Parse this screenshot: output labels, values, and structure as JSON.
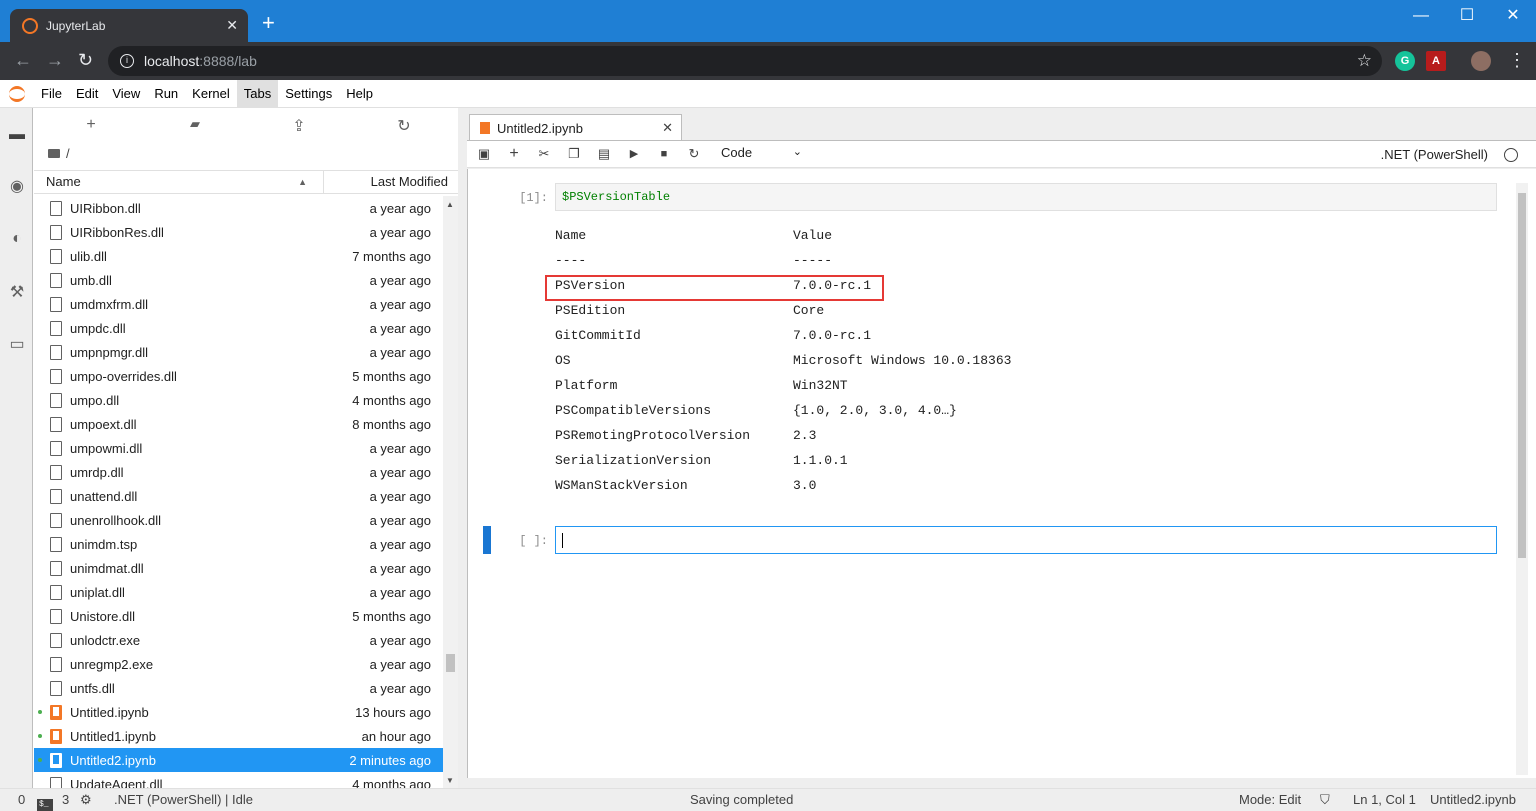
{
  "browser": {
    "tab_title": "JupyterLab",
    "tab_close": "✕",
    "new_tab": "+",
    "url_host": "localhost",
    "url_path": ":8888/lab",
    "window_min": "—",
    "window_max": "☐",
    "window_close": "✕",
    "ext_grammarly": "G",
    "ext_pdf": "A"
  },
  "menubar": {
    "items": [
      "File",
      "Edit",
      "View",
      "Run",
      "Kernel",
      "Tabs",
      "Settings",
      "Help"
    ],
    "active": "Tabs"
  },
  "filebrowser": {
    "path": "/",
    "col_name": "Name",
    "col_modified": "Last Modified",
    "files": [
      {
        "name": "UIRibbon.dll",
        "modified": "a year ago",
        "type": "file"
      },
      {
        "name": "UIRibbonRes.dll",
        "modified": "a year ago",
        "type": "file"
      },
      {
        "name": "ulib.dll",
        "modified": "7 months ago",
        "type": "file"
      },
      {
        "name": "umb.dll",
        "modified": "a year ago",
        "type": "file"
      },
      {
        "name": "umdmxfrm.dll",
        "modified": "a year ago",
        "type": "file"
      },
      {
        "name": "umpdc.dll",
        "modified": "a year ago",
        "type": "file"
      },
      {
        "name": "umpnpmgr.dll",
        "modified": "a year ago",
        "type": "file"
      },
      {
        "name": "umpo-overrides.dll",
        "modified": "5 months ago",
        "type": "file"
      },
      {
        "name": "umpo.dll",
        "modified": "4 months ago",
        "type": "file"
      },
      {
        "name": "umpoext.dll",
        "modified": "8 months ago",
        "type": "file"
      },
      {
        "name": "umpowmi.dll",
        "modified": "a year ago",
        "type": "file"
      },
      {
        "name": "umrdp.dll",
        "modified": "a year ago",
        "type": "file"
      },
      {
        "name": "unattend.dll",
        "modified": "a year ago",
        "type": "file"
      },
      {
        "name": "unenrollhook.dll",
        "modified": "a year ago",
        "type": "file"
      },
      {
        "name": "unimdm.tsp",
        "modified": "a year ago",
        "type": "file"
      },
      {
        "name": "unimdmat.dll",
        "modified": "a year ago",
        "type": "file"
      },
      {
        "name": "uniplat.dll",
        "modified": "a year ago",
        "type": "file"
      },
      {
        "name": "Unistore.dll",
        "modified": "5 months ago",
        "type": "file"
      },
      {
        "name": "unlodctr.exe",
        "modified": "a year ago",
        "type": "file"
      },
      {
        "name": "unregmp2.exe",
        "modified": "a year ago",
        "type": "file"
      },
      {
        "name": "untfs.dll",
        "modified": "a year ago",
        "type": "file"
      },
      {
        "name": "Untitled.ipynb",
        "modified": "13 hours ago",
        "type": "notebook",
        "running": true
      },
      {
        "name": "Untitled1.ipynb",
        "modified": "an hour ago",
        "type": "notebook",
        "running": true
      },
      {
        "name": "Untitled2.ipynb",
        "modified": "2 minutes ago",
        "type": "notebook",
        "running": true,
        "selected": true
      },
      {
        "name": "UpdateAgent.dll",
        "modified": "4 months ago",
        "type": "file"
      }
    ]
  },
  "notebook": {
    "tab_title": "Untitled2.ipynb",
    "cell_type": "Code",
    "kernel_name": ".NET (PowerShell)",
    "cells": [
      {
        "prompt": "[1]:",
        "source": "$PSVersionTable"
      },
      {
        "prompt": "[ ]:",
        "source": ""
      }
    ],
    "output": {
      "header": {
        "k": "Name",
        "v": "Value"
      },
      "divider": {
        "k": "----",
        "v": "-----"
      },
      "rows": [
        {
          "k": "PSVersion",
          "v": "7.0.0-rc.1"
        },
        {
          "k": "PSEdition",
          "v": "Core"
        },
        {
          "k": "GitCommitId",
          "v": "7.0.0-rc.1"
        },
        {
          "k": "OS",
          "v": "Microsoft Windows 10.0.18363"
        },
        {
          "k": "Platform",
          "v": "Win32NT"
        },
        {
          "k": "PSCompatibleVersions",
          "v": "{1.0, 2.0, 3.0, 4.0…}"
        },
        {
          "k": "PSRemotingProtocolVersion",
          "v": "2.3"
        },
        {
          "k": "SerializationVersion",
          "v": "1.1.0.1"
        },
        {
          "k": "WSManStackVersion",
          "v": "3.0"
        }
      ]
    }
  },
  "statusbar": {
    "terminals": "0",
    "kernels": "3",
    "kernel_status": ".NET (PowerShell) | Idle",
    "message": "Saving completed",
    "mode": "Mode: Edit",
    "position": "Ln 1, Col 1",
    "filename": "Untitled2.ipynb"
  },
  "colors": {
    "accent": "#2196f3",
    "jupyter_orange": "#f37726",
    "highlight": "#e53935",
    "chrome_blue": "#1f7fd4"
  }
}
